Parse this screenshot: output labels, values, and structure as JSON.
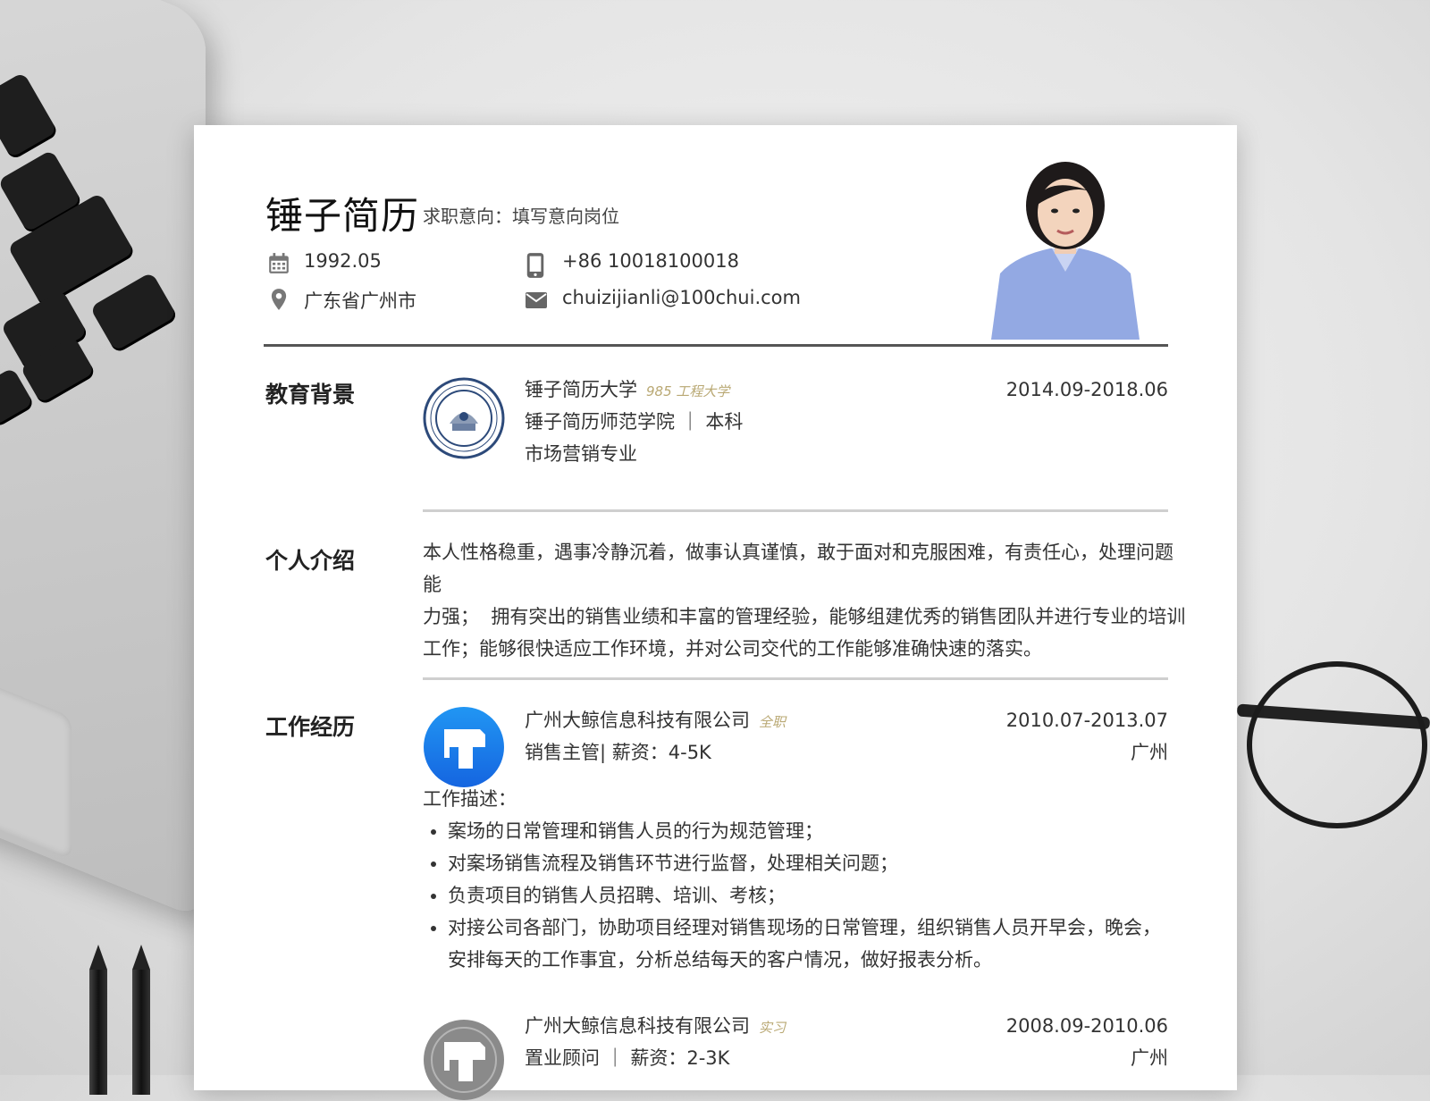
{
  "header": {
    "name": "锤子简历",
    "intent_label": "求职意向：",
    "intent_value": "填写意向岗位",
    "birth": "1992.05",
    "phone": "+86 10018100018",
    "location": "广东省广州市",
    "email": "chuizijianli@100chui.com"
  },
  "education": {
    "title": "教育背景",
    "school": "锤子简历大学",
    "school_tag": "985 工程大学",
    "college_degree": "锤子简历师范学院 ｜ 本科",
    "major": "市场营销专业",
    "period": "2014.09-2018.06"
  },
  "intro": {
    "title": "个人介绍",
    "lines": [
      "本人性格稳重，遇事冷静沉着，做事认真谨慎，敢于面对和克服困难，有责任心，处理问题能",
      "力强；  拥有突出的销售业绩和丰富的管理经验，能够组建优秀的销售团队并进行专业的培训",
      "工作；能够很快适应工作环境，并对公司交代的工作能够准确快速的落实。"
    ]
  },
  "work": {
    "title": "工作经历",
    "jobs": [
      {
        "company": "广州大鲸信息科技有限公司",
        "type": "全职",
        "position": "销售主管| 薪资：4-5K",
        "period": "2010.07-2013.07",
        "city": "广州",
        "desc_label": "工作描述：",
        "duties": [
          "案场的日常管理和销售人员的行为规范管理；",
          "对案场销售流程及销售环节进行监督，处理相关问题；",
          "负责项目的销售人员招聘、培训、考核；",
          "对接公司各部门，协助项目经理对销售现场的日常管理，组织销售人员开早会，晚会，安排每天的工作事宜，分析总结每天的客户情况，做好报表分析。"
        ]
      },
      {
        "company": "广州大鲸信息科技有限公司",
        "type": "实习",
        "position": "置业顾问 ｜ 薪资：2-3K",
        "period": "2008.09-2010.06",
        "city": "广州"
      }
    ]
  },
  "colors": {
    "accent_tag": "#b9a873",
    "logo_blue": "#1877e8",
    "logo_gray": "#8a8a8a"
  },
  "icons": [
    "calendar-icon",
    "phone-icon",
    "location-icon",
    "mail-icon"
  ]
}
